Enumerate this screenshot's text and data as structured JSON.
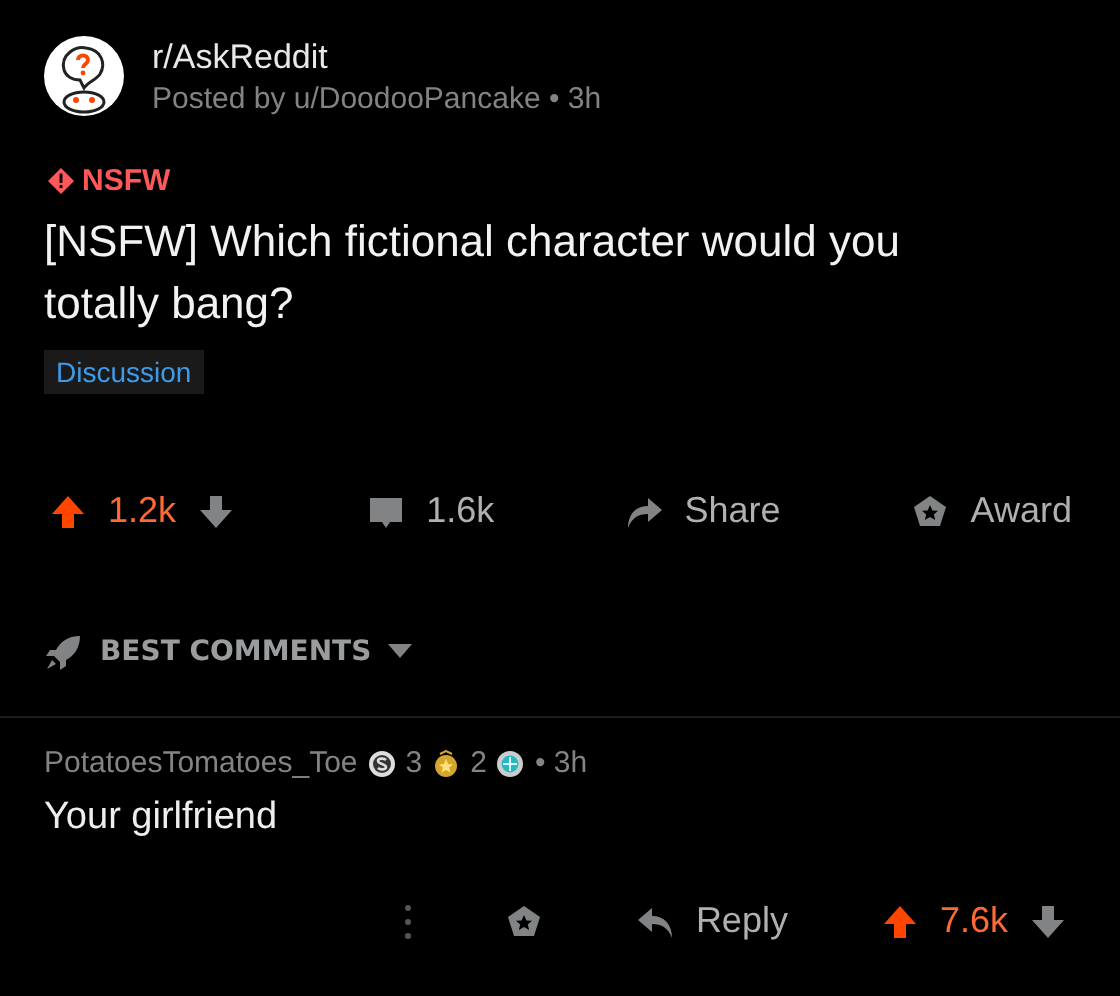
{
  "post": {
    "subreddit": "r/AskReddit",
    "byline": "Posted by u/DoodooPancake • 3h",
    "nsfw_label": "NSFW",
    "title": "[NSFW] Which fictional character would you totally bang?",
    "flair": "Discussion",
    "upvoted": true,
    "score": "1.2k",
    "comments": "1.6k",
    "share": "Share",
    "award": "Award"
  },
  "sort": {
    "label": "BEST COMMENTS"
  },
  "comments": [
    {
      "author": "PotatoesTomatoes_Toe",
      "awards": [
        {
          "kind": "silver",
          "count": "3"
        },
        {
          "kind": "gold",
          "count": "2"
        },
        {
          "kind": "platinum"
        }
      ],
      "time": "• 3h",
      "body": "Your girlfriend",
      "reply": "Reply",
      "upvoted": true,
      "score": "7.6k"
    }
  ]
}
